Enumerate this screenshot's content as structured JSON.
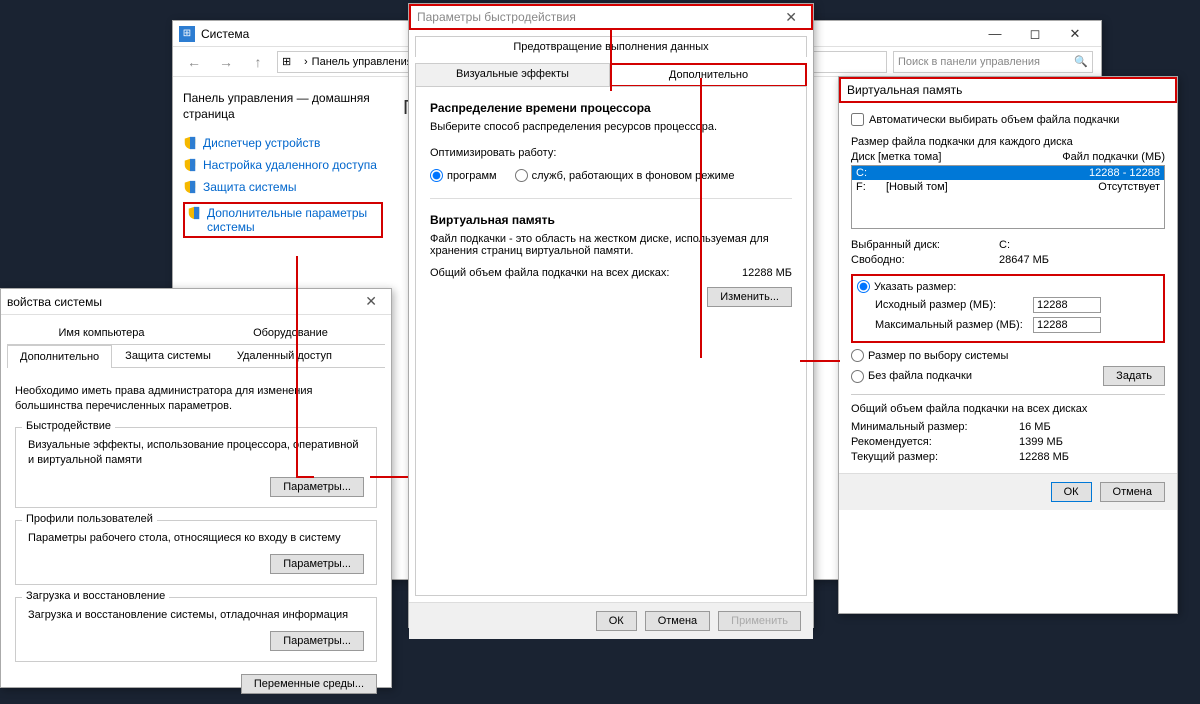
{
  "system_window": {
    "title": "Система",
    "breadcrumb": "Панель управления",
    "search_placeholder": "Поиск в панели управления",
    "sidebar": {
      "heading": "Панель управления — домашняя страница",
      "links": [
        "Диспетчер устройств",
        "Настройка удаленного доступа",
        "Защита системы",
        "Дополнительные параметры системы"
      ]
    }
  },
  "sys_props": {
    "title": "войства системы",
    "tabs_top": {
      "computer_name": "Имя компьютера",
      "hardware": "Оборудование"
    },
    "tabs_bottom": {
      "advanced": "Дополнительно",
      "protection": "Защита системы",
      "remote": "Удаленный доступ"
    },
    "note": "Необходимо иметь права администратора для изменения большинства перечисленных параметров.",
    "perf": {
      "title": "Быстродействие",
      "desc": "Визуальные эффекты, использование процессора, оперативной и виртуальной памяти"
    },
    "profiles": {
      "title": "Профили пользователей",
      "desc": "Параметры рабочего стола, относящиеся ко входу в систему"
    },
    "startup": {
      "title": "Загрузка и восстановление",
      "desc": "Загрузка и восстановление системы, отладочная информация"
    },
    "params_btn": "Параметры...",
    "env_btn": "Переменные среды..."
  },
  "perf_opts": {
    "title": "Параметры быстродействия",
    "top_tab": "Предотвращение выполнения данных",
    "tabs": {
      "visual": "Визуальные эффекты",
      "advanced": "Дополнительно"
    },
    "sched": {
      "heading": "Распределение времени процессора",
      "desc": "Выберите способ распределения ресурсов процессора.",
      "optimize": "Оптимизировать работу:",
      "prog": "программ",
      "svc": "служб, работающих в фоновом режиме"
    },
    "vm": {
      "heading": "Виртуальная память",
      "desc": "Файл подкачки - это область на жестком диске, используемая для хранения страниц виртуальной памяти.",
      "total_label": "Общий объем файла подкачки на всех дисках:",
      "total_val": "12288 МБ",
      "change_btn": "Изменить..."
    },
    "ok": "ОК",
    "cancel": "Отмена",
    "apply": "Применить"
  },
  "vmem": {
    "title": "Виртуальная память",
    "auto_chk": "Автоматически выбирать объем файла подкачки",
    "list_heading": "Размер файла подкачки для каждого диска",
    "col_disk": "Диск [метка тома]",
    "col_size": "Файл подкачки (МБ)",
    "disks": [
      {
        "letter": "C:",
        "label": "",
        "size": "12288 - 12288",
        "selected": true
      },
      {
        "letter": "F:",
        "label": "[Новый том]",
        "size": "Отсутствует",
        "selected": false
      }
    ],
    "selected_disk_lbl": "Выбранный диск:",
    "selected_disk_val": "C:",
    "free_lbl": "Свободно:",
    "free_val": "28647 МБ",
    "custom_radio": "Указать размер:",
    "initial_lbl": "Исходный размер (МБ):",
    "initial_val": "12288",
    "max_lbl": "Максимальный размер (МБ):",
    "max_val": "12288",
    "sys_radio": "Размер по выбору системы",
    "none_radio": "Без файла подкачки",
    "set_btn": "Задать",
    "summary_heading": "Общий объем файла подкачки на всех дисках",
    "min_lbl": "Минимальный размер:",
    "min_val": "16 МБ",
    "rec_lbl": "Рекомендуется:",
    "rec_val": "1399 МБ",
    "cur_lbl": "Текущий размер:",
    "cur_val": "12288 МБ",
    "ok": "ОК",
    "cancel": "Отмена"
  }
}
